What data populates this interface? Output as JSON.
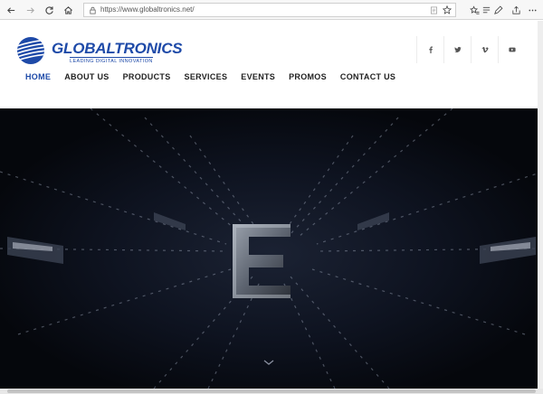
{
  "browser": {
    "url": "https://www.globaltronics.net/",
    "nav_icons": [
      "back-arrow-icon",
      "forward-arrow-icon",
      "refresh-icon",
      "home-icon"
    ],
    "tool_icons": [
      "favorites-star-icon",
      "reading-list-icon",
      "pen-icon",
      "share-icon",
      "more-icon"
    ]
  },
  "site": {
    "logo_name": "GLOBALTRONICS",
    "logo_tagline": "LEADING DIGITAL INNOVATION",
    "brand_color": "#1e4aa8",
    "social_icons": [
      "facebook-icon",
      "twitter-icon",
      "vimeo-icon",
      "youtube-icon"
    ],
    "menu": [
      {
        "label": "HOME",
        "active": true
      },
      {
        "label": "ABOUT US",
        "active": false
      },
      {
        "label": "PRODUCTS",
        "active": false
      },
      {
        "label": "SERVICES",
        "active": false
      },
      {
        "label": "EVENTS",
        "active": false
      },
      {
        "label": "PROMOS",
        "active": false
      },
      {
        "label": "CONTACT US",
        "active": false
      }
    ]
  },
  "hero": {
    "letter": "E",
    "background_color": "#0b0d14"
  }
}
